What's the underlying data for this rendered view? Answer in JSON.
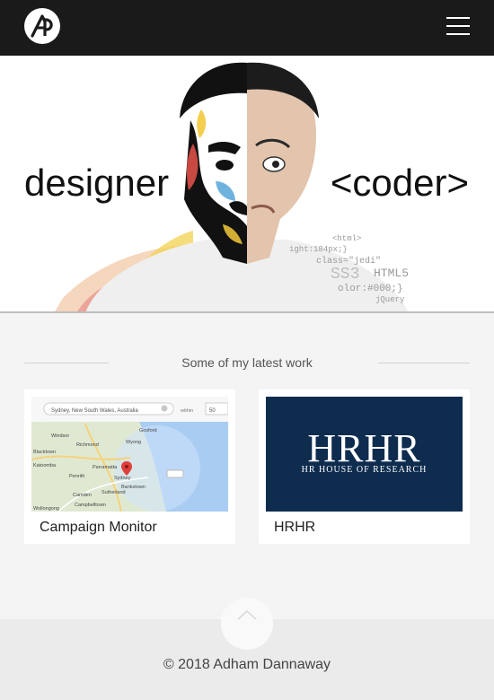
{
  "header": {
    "logo_icon": "ap-monogram-logo",
    "menu_icon": "hamburger-menu-icon"
  },
  "hero": {
    "left_word": "designer",
    "right_word": "<coder>",
    "code_lines": [
      "<html>",
      "ight:184px;}",
      "class=\"jedi\"",
      "SS3",
      "HTML5",
      "olor:#000;}",
      "jQuery"
    ]
  },
  "latest": {
    "heading": "Some of my latest work",
    "items": [
      {
        "title": "Campaign Monitor",
        "map": {
          "search_value": "Sydney, New South Wales, Australia",
          "within_label": "within",
          "within_value": "50",
          "place_labels": [
            "Gosford",
            "Richmond",
            "Windsor",
            "Wyong",
            "Katoomba",
            "Blacktown",
            "Penrith",
            "Parramatta",
            "Sydney",
            "Bankstown",
            "Camden",
            "Sutherland",
            "Campbelltown",
            "Wollongong"
          ]
        }
      },
      {
        "title": "HRHR",
        "logo_text": "HRHR",
        "logo_subtext": "HR HOUSE OF RESEARCH"
      }
    ]
  },
  "back_to_top_icon": "chevron-up-icon",
  "footer": {
    "copyright": "© 2018 Adham Dannaway"
  }
}
